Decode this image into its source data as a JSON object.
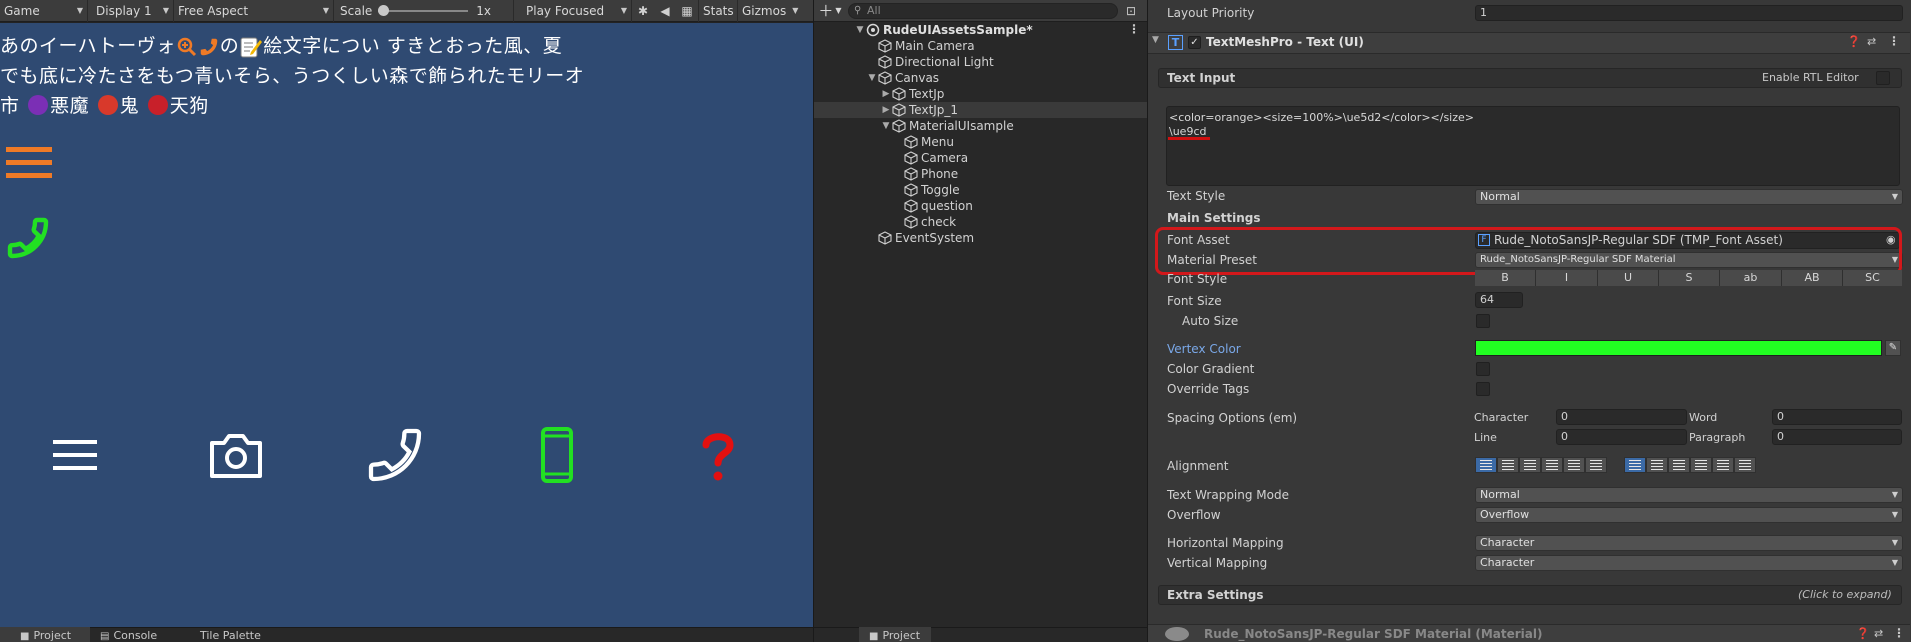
{
  "game_toolbar": {
    "view": "Game",
    "display": "Display 1",
    "aspect": "Free Aspect",
    "scale_label": "Scale",
    "scale_value": "1x",
    "play_mode": "Play Focused",
    "stats": "Stats",
    "gizmos": "Gizmos"
  },
  "game_view": {
    "line1_a": "あのイーハトーヴォ",
    "line1_b": "の",
    "line1_c": "絵文字につい すきとおった風、夏",
    "line2": "でも底に冷たさをもつ青いそら、うつくしい森で飾られたモリーオ",
    "line3_a": "市",
    "line3_b": "悪魔",
    "line3_c": "鬼",
    "line3_d": "天狗",
    "colors": {
      "background": "#2f4a72",
      "orange": "#ef7a26",
      "green": "#22e022",
      "red": "#e31010",
      "white": "#ffffff"
    }
  },
  "bottom_tabs": {
    "project": "Project",
    "console": "Console",
    "tile_palette": "Tile Palette",
    "project2": "Project"
  },
  "hierarchy": {
    "search_placeholder": "All",
    "scene": "RudeUIAssetsSample*",
    "items": [
      {
        "label": "Main Camera",
        "indent": 1
      },
      {
        "label": "Directional Light",
        "indent": 1
      },
      {
        "label": "Canvas",
        "indent": 1
      },
      {
        "label": "TextJp",
        "indent": 2
      },
      {
        "label": "TextJp_1",
        "indent": 2
      },
      {
        "label": "MaterialUIsample",
        "indent": 2
      },
      {
        "label": "Menu",
        "indent": 3
      },
      {
        "label": "Camera",
        "indent": 3
      },
      {
        "label": "Phone",
        "indent": 3
      },
      {
        "label": "Toggle",
        "indent": 3
      },
      {
        "label": "question",
        "indent": 3
      },
      {
        "label": "check",
        "indent": 3
      },
      {
        "label": "EventSystem",
        "indent": 1
      }
    ]
  },
  "inspector": {
    "layout_priority_label": "Layout Priority",
    "layout_priority_value": "1",
    "component_title": "TextMeshPro - Text (UI)",
    "text_input_header": "Text Input",
    "enable_rtl": "Enable RTL Editor",
    "text_input_line1": "<color=orange><size=100%>\\ue5d2</color></size>",
    "text_input_line2": "\\ue9cd",
    "text_style_label": "Text Style",
    "text_style_value": "Normal",
    "main_settings_header": "Main Settings",
    "font_asset_label": "Font Asset",
    "font_asset_value": "Rude_NotoSansJP-Regular SDF (TMP_Font Asset)",
    "material_preset_label": "Material Preset",
    "material_preset_value": "Rude_NotoSansJP-Regular SDF Material",
    "font_style_label": "Font Style",
    "font_style_options": [
      "B",
      "I",
      "U",
      "S",
      "ab",
      "AB",
      "SC"
    ],
    "font_size_label": "Font Size",
    "font_size_value": "64",
    "auto_size_label": "Auto Size",
    "vertex_color_label": "Vertex Color",
    "vertex_color": "#22ff22",
    "color_gradient_label": "Color Gradient",
    "override_tags_label": "Override Tags",
    "spacing_label": "Spacing Options (em)",
    "character_label": "Character",
    "character_value": "0",
    "word_label": "Word",
    "word_value": "0",
    "line_label": "Line",
    "line_value": "0",
    "paragraph_label": "Paragraph",
    "paragraph_value": "0",
    "alignment_label": "Alignment",
    "wrapping_label": "Text Wrapping Mode",
    "wrapping_value": "Normal",
    "overflow_label": "Overflow",
    "overflow_value": "Overflow",
    "hmap_label": "Horizontal Mapping",
    "hmap_value": "Character",
    "vmap_label": "Vertical Mapping",
    "vmap_value": "Character",
    "extra_settings": "Extra Settings",
    "click_to_expand": "(Click to expand)",
    "material_footer": "Rude_NotoSansJP-Regular SDF Material (Material)",
    "highlight_color": "#d3181b"
  }
}
